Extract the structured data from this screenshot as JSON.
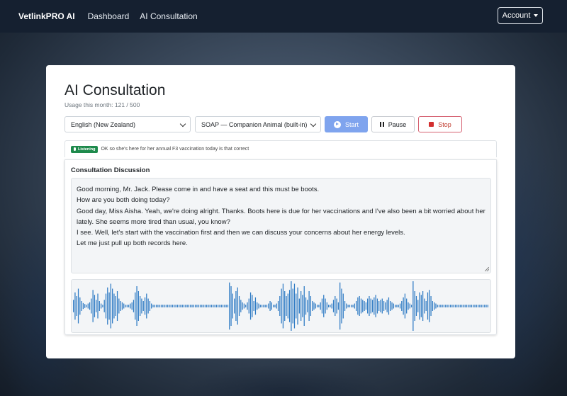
{
  "navbar": {
    "brand": "VetlinkPRO AI",
    "links": [
      "Dashboard",
      "AI Consultation"
    ],
    "account_label": "Account"
  },
  "page": {
    "title": "AI Consultation",
    "usage": "Usage this month: 121 / 500"
  },
  "controls": {
    "language": "English (New Zealand)",
    "template": "SOAP — Companion Animal (built-in)",
    "start_label": "Start",
    "pause_label": "Pause",
    "stop_label": "Stop",
    "start_color": "#7fa4ee",
    "stop_color": "#d32f2f"
  },
  "status": {
    "badge": "Listening",
    "badge_color": "#1e8a4c",
    "live_text": "OK so she's here for her annual F3 vaccination today is that correct"
  },
  "discussion": {
    "title": "Consultation Discussion",
    "lines": [
      "Good morning, Mr. Jack. Please come in and have a seat and this must be boots.",
      "How are you both doing today?",
      "Good day, Miss Aisha. Yeah, we're doing alright. Thanks. Boots here is due for her vaccinations and I've also been a bit worried about her lately. She seems more tired than usual, you know?",
      "I see. Well, let's start with the vaccination first and then we can discuss your concerns about her energy levels.",
      "Let me just pull up both records here."
    ]
  },
  "waveform": {
    "color": "#2f7bc4",
    "amplitudes": [
      0.25,
      0.55,
      0.4,
      0.7,
      0.35,
      0.2,
      0.12,
      0.08,
      0.05,
      0.1,
      0.15,
      0.3,
      0.65,
      0.45,
      0.25,
      0.5,
      0.2,
      0.1,
      0.05,
      0.25,
      0.5,
      0.75,
      0.55,
      0.9,
      0.7,
      0.5,
      0.4,
      0.6,
      0.3,
      0.2,
      0.15,
      0.1,
      0.05,
      0.05,
      0.05,
      0.1,
      0.15,
      0.25,
      0.55,
      0.8,
      0.6,
      0.4,
      0.3,
      0.2,
      0.35,
      0.5,
      0.3,
      0.2,
      0.1,
      0.05,
      0.05,
      0.05,
      0.05,
      0.05,
      0.05,
      0.05,
      0.05,
      0.05,
      0.05,
      0.05,
      0.05,
      0.05,
      0.05,
      0.05,
      0.05,
      0.05,
      0.05,
      0.05,
      0.05,
      0.05,
      0.05,
      0.05,
      0.05,
      0.05,
      0.05,
      0.05,
      0.05,
      0.05,
      0.05,
      0.05,
      0.05,
      0.05,
      0.05,
      0.05,
      0.05,
      0.05,
      0.05,
      0.05,
      0.05,
      0.05,
      0.05,
      0.05,
      0.05,
      0.05,
      0.05,
      0.05,
      0.95,
      0.8,
      0.5,
      0.3,
      0.6,
      0.75,
      0.4,
      0.25,
      0.15,
      0.1,
      0.05,
      0.15,
      0.3,
      0.55,
      0.45,
      0.2,
      0.35,
      0.15,
      0.1,
      0.05,
      0.05,
      0.05,
      0.05,
      0.05,
      0.1,
      0.2,
      0.15,
      0.05,
      0.05,
      0.1,
      0.2,
      0.4,
      0.7,
      0.9,
      0.6,
      0.4,
      0.5,
      0.65,
      1.0,
      0.7,
      0.9,
      0.5,
      0.75,
      0.3,
      0.6,
      0.45,
      0.8,
      0.35,
      0.25,
      0.6,
      0.4,
      0.2,
      0.15,
      0.1,
      0.05,
      0.05,
      0.15,
      0.3,
      0.45,
      0.3,
      0.15,
      0.05,
      0.05,
      0.1,
      0.25,
      0.4,
      0.3,
      0.15,
      0.95,
      0.7,
      0.5,
      0.2,
      0.1,
      0.05,
      0.05,
      0.05,
      0.05,
      0.1,
      0.2,
      0.35,
      0.4,
      0.3,
      0.25,
      0.2,
      0.15,
      0.3,
      0.4,
      0.3,
      0.25,
      0.35,
      0.45,
      0.3,
      0.2,
      0.25,
      0.3,
      0.2,
      0.15,
      0.25,
      0.35,
      0.2,
      0.15,
      0.1,
      0.05,
      0.05,
      0.05,
      0.1,
      0.2,
      0.35,
      0.5,
      0.3,
      0.15,
      0.1,
      0.05,
      1.0,
      0.6,
      0.4,
      0.25,
      0.55,
      0.45,
      0.6,
      0.3,
      0.2,
      0.55,
      0.65,
      0.4,
      0.2,
      0.15,
      0.1,
      0.05,
      0.05,
      0.05,
      0.05,
      0.05,
      0.05,
      0.05,
      0.05,
      0.05,
      0.05,
      0.05,
      0.05,
      0.05,
      0.05,
      0.05,
      0.05,
      0.05,
      0.05,
      0.05,
      0.05,
      0.05,
      0.05,
      0.05,
      0.05,
      0.05,
      0.05,
      0.05,
      0.05,
      0.05,
      0.05,
      0.05,
      0.05
    ]
  }
}
